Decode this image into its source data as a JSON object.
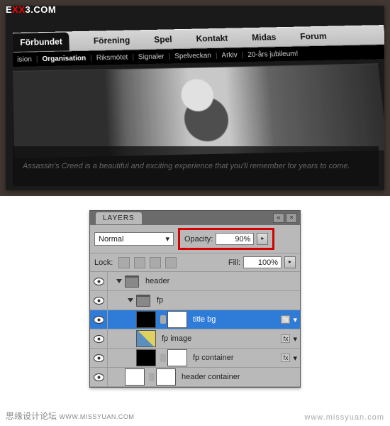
{
  "watermarks": {
    "top_logo_prefix": "E",
    "top_logo_main": "XX",
    "top_logo_suffix": "3.COM",
    "bottom_left": "思缘设计论坛",
    "bottom_left_url": "WWW.MISSYUAN.COM",
    "bottom_right": "www.missyuan.com"
  },
  "website": {
    "main_nav": [
      "Förbundet",
      "Förening",
      "Spel",
      "Kontakt",
      "Midas",
      "Forum"
    ],
    "sub_nav": [
      "ision",
      "Organisation",
      "Riksmötet",
      "Signaler",
      "Spelveckan",
      "Arkiv",
      "20-års jubileum!"
    ],
    "quote": "Assassin's Creed is a beautiful and exciting experience that you'll remember for years to come."
  },
  "layers_panel": {
    "title": "LAYERS",
    "blend_mode": "Normal",
    "opacity_label": "Opacity:",
    "opacity_value": "90%",
    "lock_label": "Lock:",
    "fill_label": "Fill:",
    "fill_value": "100%",
    "rows": [
      {
        "type": "folder",
        "indent": 0,
        "label": "header"
      },
      {
        "type": "folder",
        "indent": 1,
        "label": "fp"
      },
      {
        "type": "layer",
        "indent": 2,
        "label": "title bg",
        "selected": true,
        "thumbs": [
          "dark",
          "mask"
        ],
        "fx": true
      },
      {
        "type": "layer",
        "indent": 2,
        "label": "fp image",
        "thumbs": [
          "img"
        ],
        "fx": true
      },
      {
        "type": "layer",
        "indent": 2,
        "label": "fp container",
        "thumbs": [
          "container",
          "mask"
        ],
        "fx": true
      },
      {
        "type": "layer",
        "indent": 1,
        "label": "header container",
        "thumbs": [
          "white",
          "mask"
        ]
      }
    ]
  }
}
